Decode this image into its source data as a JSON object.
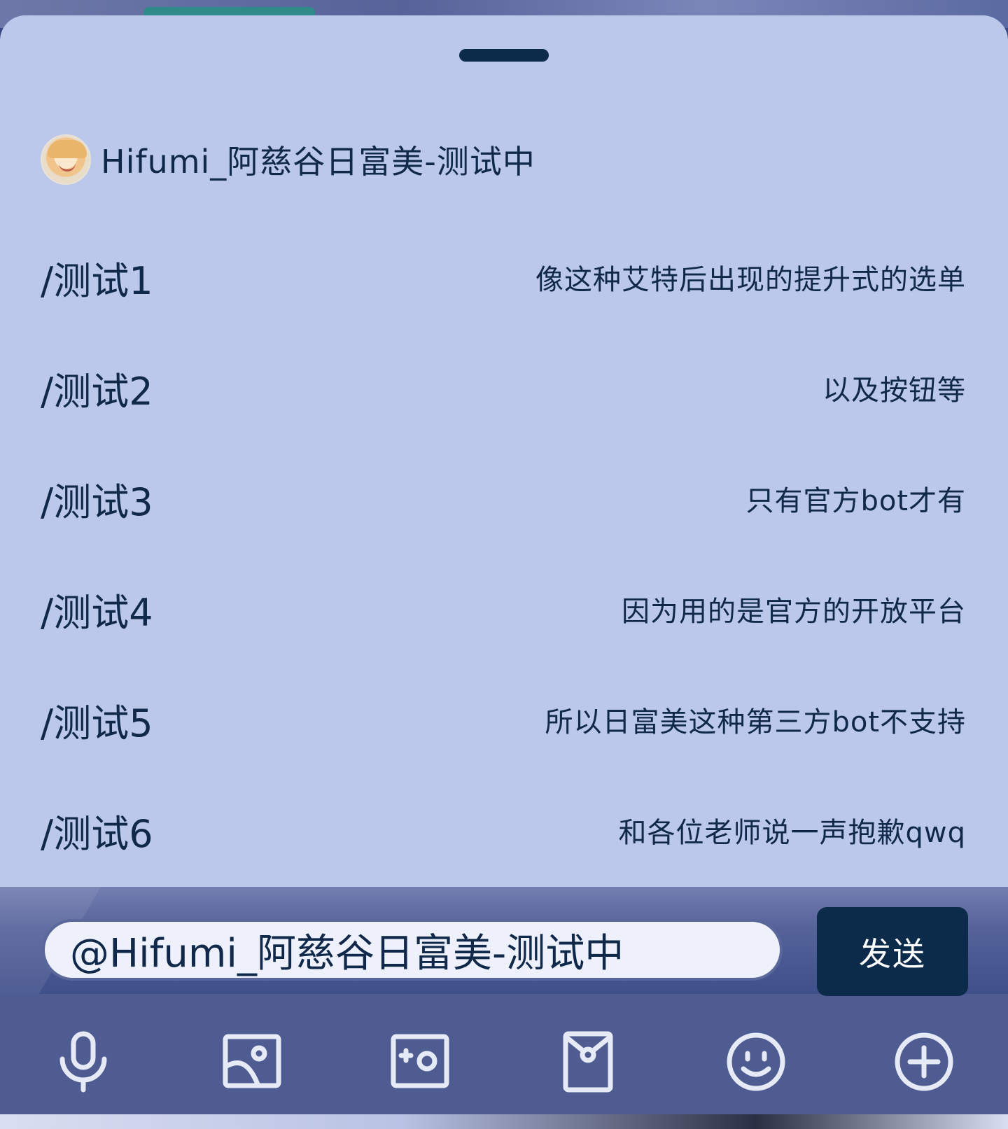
{
  "bot": {
    "name": "Hifumi_阿慈谷日富美-测试中"
  },
  "commands": [
    {
      "name": "/测试1",
      "description": "像这种艾特后出现的提升式的选单"
    },
    {
      "name": "/测试2",
      "description": "以及按钮等"
    },
    {
      "name": "/测试3",
      "description": "只有官方bot才有"
    },
    {
      "name": "/测试4",
      "description": "因为用的是官方的开放平台"
    },
    {
      "name": "/测试5",
      "description": "所以日富美这种第三方bot不支持"
    },
    {
      "name": "/测试6",
      "description": "和各位老师说一声抱歉qwq"
    }
  ],
  "input": {
    "value": "@Hifumi_阿慈谷日富美-测试中"
  },
  "send_button": {
    "label": "发送"
  },
  "toolbar": {
    "icons": [
      "microphone-icon",
      "image-icon",
      "camera-icon",
      "red-packet-icon",
      "emoji-icon",
      "plus-icon"
    ]
  },
  "colors": {
    "sheet_background": "#bbc8ea",
    "text": "#10294a",
    "accent": "#0c2a4a",
    "toolbar_background": "#4e5c92"
  }
}
